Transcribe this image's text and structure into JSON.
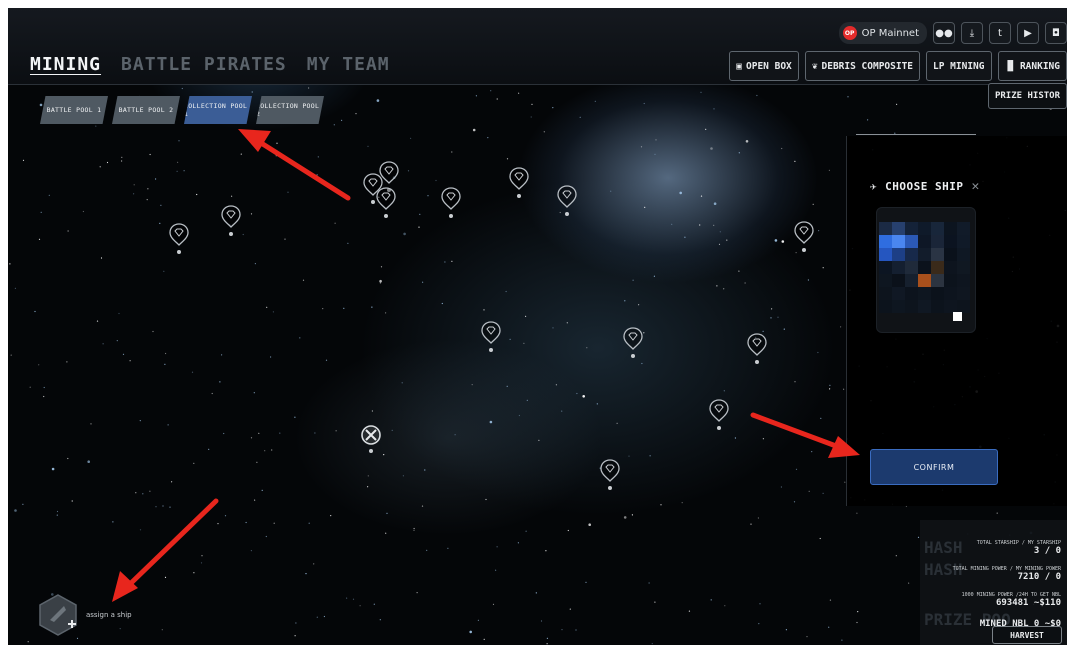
{
  "nav": {
    "tabs": [
      {
        "label": "MINING"
      },
      {
        "label": "BATTLE PIRATES"
      },
      {
        "label": "MY TEAM"
      }
    ]
  },
  "network": {
    "badge": "OP",
    "label": "OP Mainnet"
  },
  "social_icons": [
    "medium-icon",
    "download-icon",
    "twitter-icon",
    "youtube-icon",
    "discord-icon"
  ],
  "actions": [
    {
      "label": "OPEN BOX",
      "icon": "box-icon"
    },
    {
      "label": "DEBRIS COMPOSITE",
      "icon": "debris-icon"
    },
    {
      "label": "LP MINING",
      "icon": ""
    },
    {
      "label": "RANKING",
      "icon": "bar-chart-icon"
    }
  ],
  "prize_history_label": "PRIZE HISTOR",
  "pools": [
    {
      "label": "BATTLE POOL 1",
      "active": false
    },
    {
      "label": "BATTLE POOL 2",
      "active": false
    },
    {
      "label": "COLLECTION POOL 1",
      "active": true
    },
    {
      "label": "COLLECTION POOL 2",
      "active": false
    }
  ],
  "choose_ship": {
    "title": "CHOOSE SHIP",
    "confirm_label": "CONFIRM"
  },
  "stats": {
    "starship_label": "TOTAL STARSHIP / MY STARSHIP",
    "starship_value": "3 / 0",
    "power_label": "TOTAL MINING POWER / MY MINING POWER",
    "power_value": "7210 / 0",
    "nbl_label": "1000 MINING POWER /24H TO GET NBL",
    "nbl_value": "693481 ~$110",
    "mined_value": "MINED NBL 0 ~$0",
    "harvest_label": "HARVEST",
    "watermark_top": "HASH",
    "watermark_bottom": "PRIZE POO"
  },
  "assign": {
    "label": "assign a ship"
  },
  "colors": {
    "accent": "#3b5d96",
    "arrow": "#e8261d",
    "confirm": "#1c3a6e"
  }
}
